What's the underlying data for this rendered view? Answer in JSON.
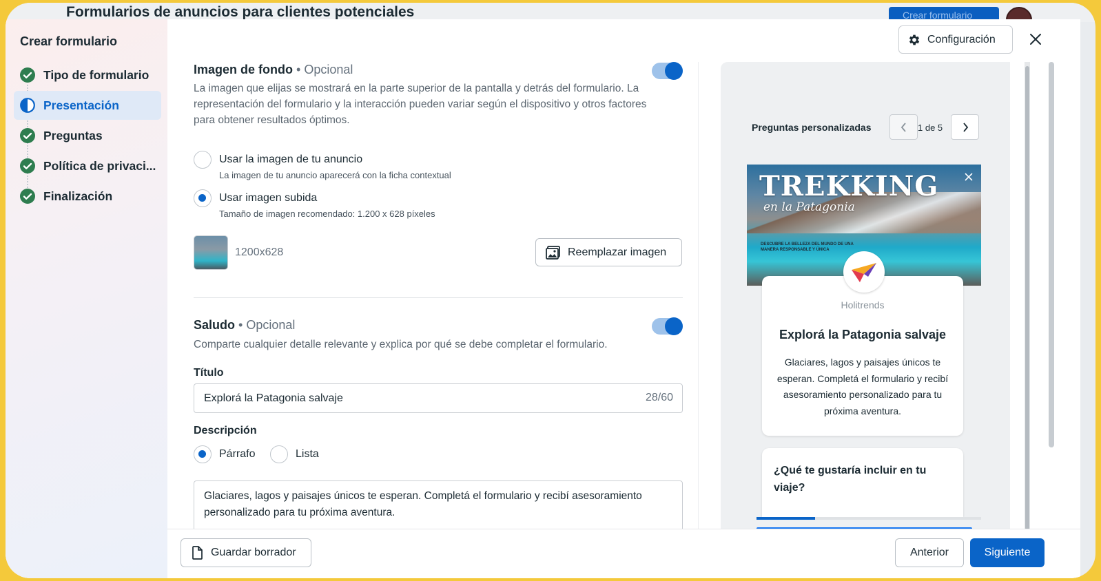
{
  "background_page": {
    "title": "Formularios de anuncios para clientes potenciales",
    "button_label": "Crear formulario"
  },
  "sidebar": {
    "title": "Crear formulario",
    "steps": [
      {
        "label": "Tipo de formulario",
        "state": "done"
      },
      {
        "label": "Presentación",
        "state": "active"
      },
      {
        "label": "Preguntas",
        "state": "done"
      },
      {
        "label": "Política de privaci...",
        "state": "done"
      },
      {
        "label": "Finalización",
        "state": "done"
      }
    ]
  },
  "header": {
    "settings_label": "Configuración"
  },
  "background_image": {
    "title": "Imagen de fondo",
    "optional": "• Opcional",
    "description": "La imagen que elijas se mostrará en la parte superior de la pantalla y detrás del formulario. La representación del formulario y la interacción pueden variar según el dispositivo y otros factores para obtener resultados óptimos.",
    "enabled": true,
    "options": [
      {
        "label": "Usar la imagen de tu anuncio",
        "sub": "La imagen de tu anuncio aparecerá con la ficha contextual",
        "selected": false
      },
      {
        "label": "Usar imagen subida",
        "sub": "Tamaño de imagen recomendado: 1.200 x 628 píxeles",
        "selected": true
      }
    ],
    "dimensions": "1200x628",
    "replace_label": "Reemplazar imagen"
  },
  "greeting": {
    "title": "Saludo",
    "optional": "• Opcional",
    "description": "Comparte cualquier detalle relevante y explica por qué se debe completar el formulario.",
    "enabled": true,
    "title_label": "Título",
    "title_value": "Explorá la Patagonia salvaje",
    "title_counter": "28/60",
    "description_label": "Descripción",
    "format_options": [
      {
        "label": "Párrafo",
        "selected": true
      },
      {
        "label": "Lista",
        "selected": false
      }
    ],
    "description_value": "Glaciares, lagos y paisajes únicos te esperan. Completá el formulario y recibí asesoramiento personalizado para tu próxima aventura."
  },
  "preview": {
    "section_label": "Preguntas personalizadas",
    "page_indicator": "1 de 5",
    "hero_title": "TREKKING",
    "hero_subtitle": "en la Patagonia",
    "hero_small_text": "DESCUBRE LA BELLEZA DEL MUNDO DE UNA MANERA RESPONSABLE Y ÚNICA",
    "brand": "Holitrends",
    "card_title": "Explorá la Patagonia salvaje",
    "card_description": "Glaciares, lagos y paisajes únicos te esperan. Completá el formulario y recibí asesoramiento personalizado para tu próxima aventura.",
    "question": "¿Qué te gustaría incluir en tu viaje?",
    "progress": 0.26
  },
  "footer": {
    "save_draft_label": "Guardar borrador",
    "previous_label": "Anterior",
    "next_label": "Siguiente"
  },
  "colors": {
    "accent": "#0a64c8",
    "frame": "#f4c93b",
    "success": "#2e7d4f"
  }
}
